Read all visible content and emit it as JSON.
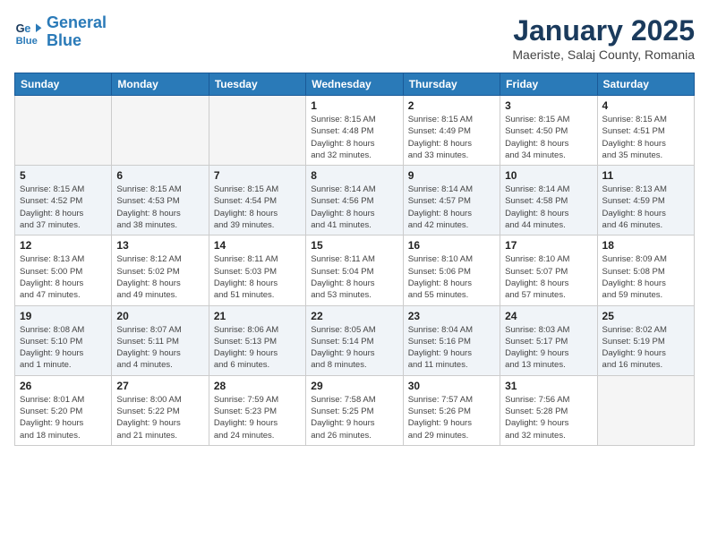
{
  "header": {
    "logo_line1": "General",
    "logo_line2": "Blue",
    "month": "January 2025",
    "location": "Maeriste, Salaj County, Romania"
  },
  "weekdays": [
    "Sunday",
    "Monday",
    "Tuesday",
    "Wednesday",
    "Thursday",
    "Friday",
    "Saturday"
  ],
  "weeks": [
    [
      {
        "day": "",
        "info": ""
      },
      {
        "day": "",
        "info": ""
      },
      {
        "day": "",
        "info": ""
      },
      {
        "day": "1",
        "info": "Sunrise: 8:15 AM\nSunset: 4:48 PM\nDaylight: 8 hours\nand 32 minutes."
      },
      {
        "day": "2",
        "info": "Sunrise: 8:15 AM\nSunset: 4:49 PM\nDaylight: 8 hours\nand 33 minutes."
      },
      {
        "day": "3",
        "info": "Sunrise: 8:15 AM\nSunset: 4:50 PM\nDaylight: 8 hours\nand 34 minutes."
      },
      {
        "day": "4",
        "info": "Sunrise: 8:15 AM\nSunset: 4:51 PM\nDaylight: 8 hours\nand 35 minutes."
      }
    ],
    [
      {
        "day": "5",
        "info": "Sunrise: 8:15 AM\nSunset: 4:52 PM\nDaylight: 8 hours\nand 37 minutes."
      },
      {
        "day": "6",
        "info": "Sunrise: 8:15 AM\nSunset: 4:53 PM\nDaylight: 8 hours\nand 38 minutes."
      },
      {
        "day": "7",
        "info": "Sunrise: 8:15 AM\nSunset: 4:54 PM\nDaylight: 8 hours\nand 39 minutes."
      },
      {
        "day": "8",
        "info": "Sunrise: 8:14 AM\nSunset: 4:56 PM\nDaylight: 8 hours\nand 41 minutes."
      },
      {
        "day": "9",
        "info": "Sunrise: 8:14 AM\nSunset: 4:57 PM\nDaylight: 8 hours\nand 42 minutes."
      },
      {
        "day": "10",
        "info": "Sunrise: 8:14 AM\nSunset: 4:58 PM\nDaylight: 8 hours\nand 44 minutes."
      },
      {
        "day": "11",
        "info": "Sunrise: 8:13 AM\nSunset: 4:59 PM\nDaylight: 8 hours\nand 46 minutes."
      }
    ],
    [
      {
        "day": "12",
        "info": "Sunrise: 8:13 AM\nSunset: 5:00 PM\nDaylight: 8 hours\nand 47 minutes."
      },
      {
        "day": "13",
        "info": "Sunrise: 8:12 AM\nSunset: 5:02 PM\nDaylight: 8 hours\nand 49 minutes."
      },
      {
        "day": "14",
        "info": "Sunrise: 8:11 AM\nSunset: 5:03 PM\nDaylight: 8 hours\nand 51 minutes."
      },
      {
        "day": "15",
        "info": "Sunrise: 8:11 AM\nSunset: 5:04 PM\nDaylight: 8 hours\nand 53 minutes."
      },
      {
        "day": "16",
        "info": "Sunrise: 8:10 AM\nSunset: 5:06 PM\nDaylight: 8 hours\nand 55 minutes."
      },
      {
        "day": "17",
        "info": "Sunrise: 8:10 AM\nSunset: 5:07 PM\nDaylight: 8 hours\nand 57 minutes."
      },
      {
        "day": "18",
        "info": "Sunrise: 8:09 AM\nSunset: 5:08 PM\nDaylight: 8 hours\nand 59 minutes."
      }
    ],
    [
      {
        "day": "19",
        "info": "Sunrise: 8:08 AM\nSunset: 5:10 PM\nDaylight: 9 hours\nand 1 minute."
      },
      {
        "day": "20",
        "info": "Sunrise: 8:07 AM\nSunset: 5:11 PM\nDaylight: 9 hours\nand 4 minutes."
      },
      {
        "day": "21",
        "info": "Sunrise: 8:06 AM\nSunset: 5:13 PM\nDaylight: 9 hours\nand 6 minutes."
      },
      {
        "day": "22",
        "info": "Sunrise: 8:05 AM\nSunset: 5:14 PM\nDaylight: 9 hours\nand 8 minutes."
      },
      {
        "day": "23",
        "info": "Sunrise: 8:04 AM\nSunset: 5:16 PM\nDaylight: 9 hours\nand 11 minutes."
      },
      {
        "day": "24",
        "info": "Sunrise: 8:03 AM\nSunset: 5:17 PM\nDaylight: 9 hours\nand 13 minutes."
      },
      {
        "day": "25",
        "info": "Sunrise: 8:02 AM\nSunset: 5:19 PM\nDaylight: 9 hours\nand 16 minutes."
      }
    ],
    [
      {
        "day": "26",
        "info": "Sunrise: 8:01 AM\nSunset: 5:20 PM\nDaylight: 9 hours\nand 18 minutes."
      },
      {
        "day": "27",
        "info": "Sunrise: 8:00 AM\nSunset: 5:22 PM\nDaylight: 9 hours\nand 21 minutes."
      },
      {
        "day": "28",
        "info": "Sunrise: 7:59 AM\nSunset: 5:23 PM\nDaylight: 9 hours\nand 24 minutes."
      },
      {
        "day": "29",
        "info": "Sunrise: 7:58 AM\nSunset: 5:25 PM\nDaylight: 9 hours\nand 26 minutes."
      },
      {
        "day": "30",
        "info": "Sunrise: 7:57 AM\nSunset: 5:26 PM\nDaylight: 9 hours\nand 29 minutes."
      },
      {
        "day": "31",
        "info": "Sunrise: 7:56 AM\nSunset: 5:28 PM\nDaylight: 9 hours\nand 32 minutes."
      },
      {
        "day": "",
        "info": ""
      }
    ]
  ]
}
